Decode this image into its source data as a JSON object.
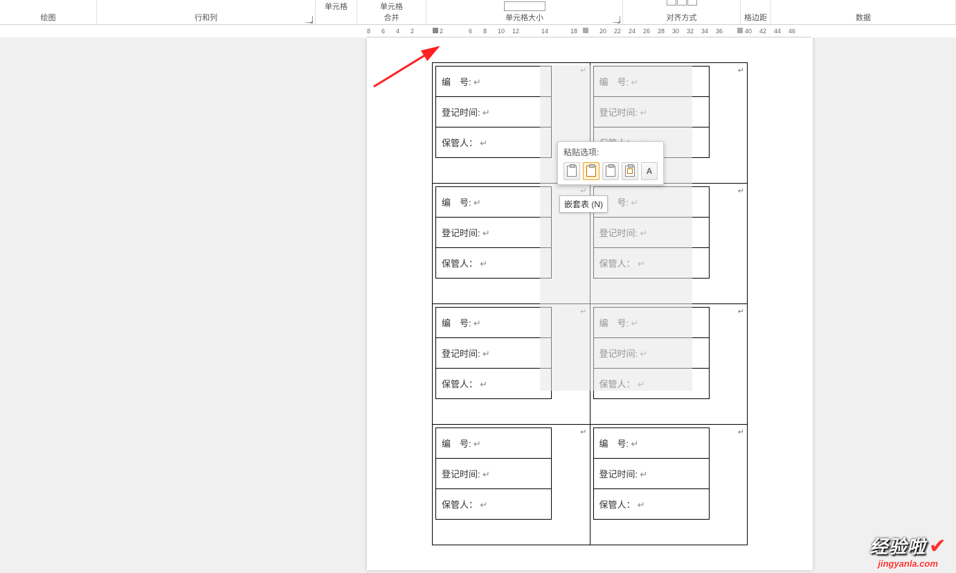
{
  "ribbon": {
    "groups": {
      "drawing": "绘图",
      "rows_cols": "行和列",
      "cell1": "单元格",
      "cell2": "单元格",
      "merge": "合并",
      "cell_size": "单元格大小",
      "alignment": "对齐方式",
      "margins": "格边距",
      "data": "数据"
    }
  },
  "ruler": {
    "ticks": [
      "8",
      "6",
      "4",
      "2",
      "",
      "2",
      "",
      "6",
      "8",
      "10",
      "12",
      "",
      "14",
      "",
      "18",
      "",
      "20",
      "22",
      "24",
      "26",
      "28",
      "30",
      "32",
      "34",
      "36",
      "",
      "40",
      "42",
      "44",
      "46"
    ]
  },
  "paste_popup": {
    "title": "粘贴选项:",
    "tooltip": "嵌套表 (N)"
  },
  "labels": {
    "row1": "编　号:",
    "row2": "登记时间:",
    "row3": "保管人："
  },
  "watermark": {
    "main": "经验啦",
    "sub": "jingyanla.com"
  },
  "chart_data": {
    "type": "table",
    "description": "Word document containing an outer 4×2 table; each cell contains a nested 3×1 table with label fields.",
    "outer_grid": {
      "rows": 4,
      "cols": 2
    },
    "nested_table_rows": [
      "编　号:",
      "登记时间:",
      "保管人："
    ],
    "blocks": [
      {
        "row": 1,
        "col": 1,
        "values": [
          "",
          "",
          ""
        ]
      },
      {
        "row": 1,
        "col": 2,
        "values": [
          "",
          "",
          ""
        ]
      },
      {
        "row": 2,
        "col": 1,
        "values": [
          "",
          "",
          ""
        ]
      },
      {
        "row": 2,
        "col": 2,
        "values": [
          "",
          "",
          ""
        ]
      },
      {
        "row": 3,
        "col": 1,
        "values": [
          "",
          "",
          ""
        ]
      },
      {
        "row": 3,
        "col": 2,
        "values": [
          "",
          "",
          ""
        ]
      },
      {
        "row": 4,
        "col": 1,
        "values": [
          "",
          "",
          ""
        ]
      },
      {
        "row": 4,
        "col": 2,
        "values": [
          "",
          "",
          ""
        ]
      }
    ]
  }
}
